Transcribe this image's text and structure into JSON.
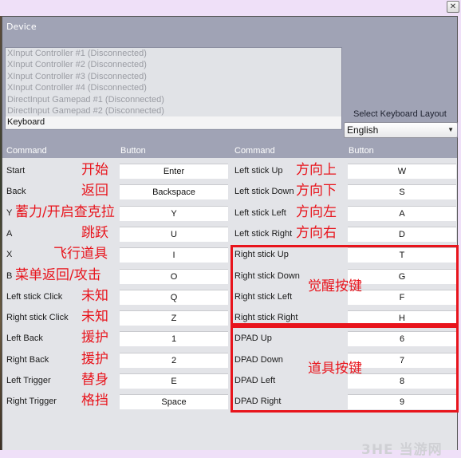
{
  "titlebar": {
    "close_icon": "close-icon"
  },
  "device": {
    "label": "Device",
    "items": [
      "XInput Controller #1 (Disconnected)",
      "XInput Controller #2 (Disconnected)",
      "XInput Controller #3 (Disconnected)",
      "XInput Controller #4 (Disconnected)",
      "DirectInput Gamepad #1 (Disconnected)",
      "DirectInput Gamepad #2 (Disconnected)",
      "Keyboard"
    ],
    "selected": "Keyboard"
  },
  "keyboard_layout": {
    "label": "Select Keyboard Layout",
    "value": "English"
  },
  "headers": {
    "command": "Command",
    "button": "Button"
  },
  "left_bindings": [
    {
      "command": "Start",
      "key": "Enter",
      "note": "开始"
    },
    {
      "command": "Back",
      "key": "Backspace",
      "note": "返回"
    },
    {
      "command": "Y",
      "key": "Y",
      "note": "蓄力/开启查克拉"
    },
    {
      "command": "A",
      "key": "U",
      "note": "跳跃"
    },
    {
      "command": "X",
      "key": "I",
      "note": "飞行道具"
    },
    {
      "command": "B",
      "key": "O",
      "note": "菜单返回/攻击"
    },
    {
      "command": "Left stick Click",
      "key": "Q",
      "note": "未知"
    },
    {
      "command": "Right stick Click",
      "key": "Z",
      "note": "未知"
    },
    {
      "command": "Left Back",
      "key": "1",
      "note": "援护"
    },
    {
      "command": "Right Back",
      "key": "2",
      "note": "援护"
    },
    {
      "command": "Left Trigger",
      "key": "E",
      "note": "替身"
    },
    {
      "command": "Right Trigger",
      "key": "Space",
      "note": "格挡"
    }
  ],
  "right_bindings": [
    {
      "command": "Left stick Up",
      "key": "W",
      "note": "方向上"
    },
    {
      "command": "Left stick Down",
      "key": "S",
      "note": "方向下"
    },
    {
      "command": "Left stick Left",
      "key": "A",
      "note": "方向左"
    },
    {
      "command": "Left stick Right",
      "key": "D",
      "note": "方向右"
    },
    {
      "command": "Right stick Up",
      "key": "T",
      "note": ""
    },
    {
      "command": "Right stick Down",
      "key": "G",
      "note": ""
    },
    {
      "command": "Right stick Left",
      "key": "F",
      "note": ""
    },
    {
      "command": "Right stick Right",
      "key": "H",
      "note": ""
    },
    {
      "command": "DPAD Up",
      "key": "6",
      "note": ""
    },
    {
      "command": "DPAD Down",
      "key": "7",
      "note": ""
    },
    {
      "command": "DPAD Left",
      "key": "8",
      "note": ""
    },
    {
      "command": "DPAD Right",
      "key": "9",
      "note": ""
    }
  ],
  "group_annotations": {
    "right_stick": "觉醒按键",
    "dpad": "道具按键"
  },
  "watermark": "3HE 当游网",
  "colors": {
    "annotation": "#e8141c",
    "panel": "#a0a3b5"
  }
}
